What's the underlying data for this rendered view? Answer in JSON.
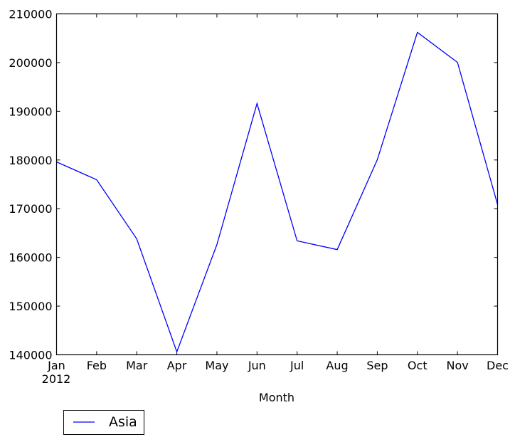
{
  "chart_data": {
    "type": "line",
    "title": "",
    "xlabel": "Month",
    "ylabel": "",
    "categories": [
      "Jan",
      "Feb",
      "Mar",
      "Apr",
      "May",
      "Jun",
      "Jul",
      "Aug",
      "Sep",
      "Oct",
      "Nov",
      "Dec"
    ],
    "x_year_label": "2012",
    "ylim": [
      140000,
      210000
    ],
    "yticks": [
      140000,
      150000,
      160000,
      170000,
      180000,
      190000,
      200000,
      210000
    ],
    "ytick_labels": [
      "140000",
      "150000",
      "160000",
      "170000",
      "180000",
      "190000",
      "200000",
      "210000"
    ],
    "grid": false,
    "legend_position": "below-left",
    "series": [
      {
        "name": "Asia",
        "color": "#0000ff",
        "values": [
          179600,
          175950,
          163800,
          140600,
          162650,
          191600,
          163400,
          161600,
          180050,
          206200,
          200050,
          170850
        ]
      }
    ]
  }
}
